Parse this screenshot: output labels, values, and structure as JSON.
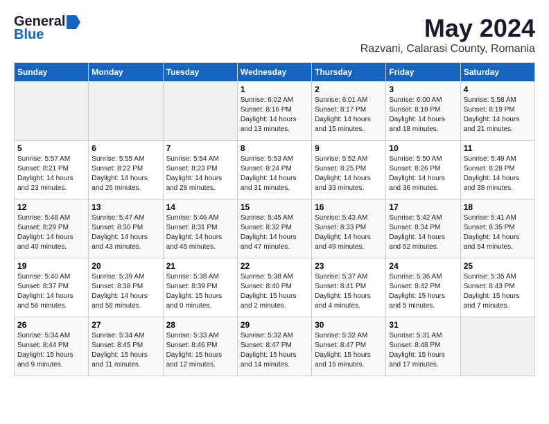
{
  "header": {
    "logo_general": "General",
    "logo_blue": "Blue",
    "month": "May 2024",
    "location": "Razvani, Calarasi County, Romania"
  },
  "weekdays": [
    "Sunday",
    "Monday",
    "Tuesday",
    "Wednesday",
    "Thursday",
    "Friday",
    "Saturday"
  ],
  "weeks": [
    [
      {
        "day": "",
        "info": ""
      },
      {
        "day": "",
        "info": ""
      },
      {
        "day": "",
        "info": ""
      },
      {
        "day": "1",
        "info": "Sunrise: 6:02 AM\nSunset: 8:16 PM\nDaylight: 14 hours\nand 13 minutes."
      },
      {
        "day": "2",
        "info": "Sunrise: 6:01 AM\nSunset: 8:17 PM\nDaylight: 14 hours\nand 15 minutes."
      },
      {
        "day": "3",
        "info": "Sunrise: 6:00 AM\nSunset: 8:18 PM\nDaylight: 14 hours\nand 18 minutes."
      },
      {
        "day": "4",
        "info": "Sunrise: 5:58 AM\nSunset: 8:19 PM\nDaylight: 14 hours\nand 21 minutes."
      }
    ],
    [
      {
        "day": "5",
        "info": "Sunrise: 5:57 AM\nSunset: 8:21 PM\nDaylight: 14 hours\nand 23 minutes."
      },
      {
        "day": "6",
        "info": "Sunrise: 5:55 AM\nSunset: 8:22 PM\nDaylight: 14 hours\nand 26 minutes."
      },
      {
        "day": "7",
        "info": "Sunrise: 5:54 AM\nSunset: 8:23 PM\nDaylight: 14 hours\nand 28 minutes."
      },
      {
        "day": "8",
        "info": "Sunrise: 5:53 AM\nSunset: 8:24 PM\nDaylight: 14 hours\nand 31 minutes."
      },
      {
        "day": "9",
        "info": "Sunrise: 5:52 AM\nSunset: 8:25 PM\nDaylight: 14 hours\nand 33 minutes."
      },
      {
        "day": "10",
        "info": "Sunrise: 5:50 AM\nSunset: 8:26 PM\nDaylight: 14 hours\nand 36 minutes."
      },
      {
        "day": "11",
        "info": "Sunrise: 5:49 AM\nSunset: 8:28 PM\nDaylight: 14 hours\nand 38 minutes."
      }
    ],
    [
      {
        "day": "12",
        "info": "Sunrise: 5:48 AM\nSunset: 8:29 PM\nDaylight: 14 hours\nand 40 minutes."
      },
      {
        "day": "13",
        "info": "Sunrise: 5:47 AM\nSunset: 8:30 PM\nDaylight: 14 hours\nand 43 minutes."
      },
      {
        "day": "14",
        "info": "Sunrise: 5:46 AM\nSunset: 8:31 PM\nDaylight: 14 hours\nand 45 minutes."
      },
      {
        "day": "15",
        "info": "Sunrise: 5:45 AM\nSunset: 8:32 PM\nDaylight: 14 hours\nand 47 minutes."
      },
      {
        "day": "16",
        "info": "Sunrise: 5:43 AM\nSunset: 8:33 PM\nDaylight: 14 hours\nand 49 minutes."
      },
      {
        "day": "17",
        "info": "Sunrise: 5:42 AM\nSunset: 8:34 PM\nDaylight: 14 hours\nand 52 minutes."
      },
      {
        "day": "18",
        "info": "Sunrise: 5:41 AM\nSunset: 8:35 PM\nDaylight: 14 hours\nand 54 minutes."
      }
    ],
    [
      {
        "day": "19",
        "info": "Sunrise: 5:40 AM\nSunset: 8:37 PM\nDaylight: 14 hours\nand 56 minutes."
      },
      {
        "day": "20",
        "info": "Sunrise: 5:39 AM\nSunset: 8:38 PM\nDaylight: 14 hours\nand 58 minutes."
      },
      {
        "day": "21",
        "info": "Sunrise: 5:38 AM\nSunset: 8:39 PM\nDaylight: 15 hours\nand 0 minutes."
      },
      {
        "day": "22",
        "info": "Sunrise: 5:38 AM\nSunset: 8:40 PM\nDaylight: 15 hours\nand 2 minutes."
      },
      {
        "day": "23",
        "info": "Sunrise: 5:37 AM\nSunset: 8:41 PM\nDaylight: 15 hours\nand 4 minutes."
      },
      {
        "day": "24",
        "info": "Sunrise: 5:36 AM\nSunset: 8:42 PM\nDaylight: 15 hours\nand 5 minutes."
      },
      {
        "day": "25",
        "info": "Sunrise: 5:35 AM\nSunset: 8:43 PM\nDaylight: 15 hours\nand 7 minutes."
      }
    ],
    [
      {
        "day": "26",
        "info": "Sunrise: 5:34 AM\nSunset: 8:44 PM\nDaylight: 15 hours\nand 9 minutes."
      },
      {
        "day": "27",
        "info": "Sunrise: 5:34 AM\nSunset: 8:45 PM\nDaylight: 15 hours\nand 11 minutes."
      },
      {
        "day": "28",
        "info": "Sunrise: 5:33 AM\nSunset: 8:46 PM\nDaylight: 15 hours\nand 12 minutes."
      },
      {
        "day": "29",
        "info": "Sunrise: 5:32 AM\nSunset: 8:47 PM\nDaylight: 15 hours\nand 14 minutes."
      },
      {
        "day": "30",
        "info": "Sunrise: 5:32 AM\nSunset: 8:47 PM\nDaylight: 15 hours\nand 15 minutes."
      },
      {
        "day": "31",
        "info": "Sunrise: 5:31 AM\nSunset: 8:48 PM\nDaylight: 15 hours\nand 17 minutes."
      },
      {
        "day": "",
        "info": ""
      }
    ]
  ]
}
